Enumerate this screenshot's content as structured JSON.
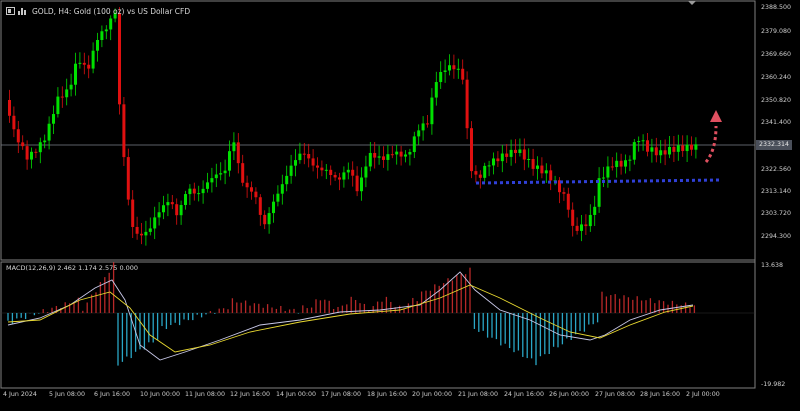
{
  "window": {
    "title": "GOLD, H4:  Gold (100 oz) vs US Dollar CFD",
    "current_price": "2332.314"
  },
  "price_axis": {
    "labels": [
      "2388.500",
      "2379.080",
      "2369.660",
      "2360.240",
      "2350.820",
      "2341.400",
      "2322.560",
      "2313.140",
      "2303.720",
      "2294.300"
    ],
    "min": 2285.0,
    "max": 2390.0
  },
  "macd": {
    "label": "MACD(12,26,9) 2.462 1.174 2.575 0.000",
    "axis_labels": [
      "13.638",
      "-19.982"
    ],
    "histogram_colors": {
      "up": "#b82828",
      "down": "#2aa6c6"
    },
    "main_color": "#c8c8e8",
    "signal_color": "#e8d830"
  },
  "time_axis": {
    "labels": [
      "4 Jun 2024",
      "5 Jun 08:00",
      "6 Jun 16:00",
      "10 Jun 00:00",
      "11 Jun 08:00",
      "12 Jun 16:00",
      "14 Jun 00:00",
      "17 Jun 08:00",
      "18 Jun 16:00",
      "20 Jun 00:00",
      "21 Jun 08:00",
      "24 Jun 16:00",
      "26 Jun 00:00",
      "27 Jun 08:00",
      "28 Jun 16:00",
      "2 Jul 00:00"
    ]
  },
  "colors": {
    "background": "#000000",
    "bull": "#00e000",
    "bear": "#e01010",
    "grid": "#3c3c3c",
    "support_line": "#3040d8",
    "forecast_arrow": "#e05060"
  },
  "icons": [
    "chart-window-icon",
    "bar-chart-icon"
  ]
}
